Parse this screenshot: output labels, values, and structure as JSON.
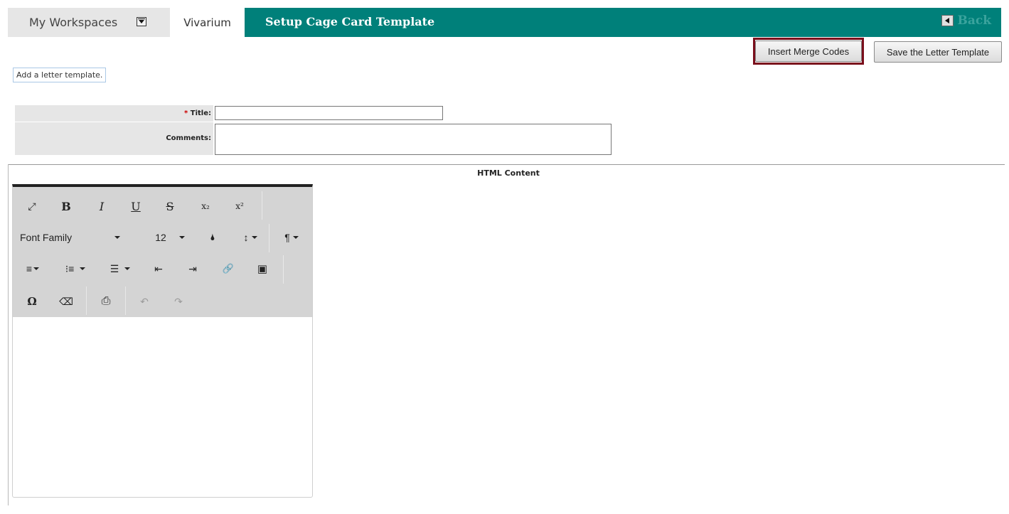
{
  "header": {
    "workspaces_label": "My Workspaces",
    "active_tab": "Vivarium",
    "page_title": "Setup Cage Card Template",
    "back_label": "Back"
  },
  "actions": {
    "insert_merge_codes": "Insert Merge Codes",
    "save_template": "Save the Letter Template"
  },
  "intro_text": "Add a letter template.",
  "form": {
    "required_mark": "*",
    "title_label": "Title:",
    "title_value": "",
    "comments_label": "Comments:",
    "comments_value": ""
  },
  "content_heading": "HTML Content",
  "editor": {
    "buttons": {
      "fullscreen": "⤢",
      "bold": "B",
      "italic": "I",
      "underline": "U",
      "strike": "S",
      "subscript": "x₂",
      "superscript": "x²",
      "font_family": "Font Family",
      "font_size": "12",
      "color": "🌢",
      "line_height": "↕",
      "paragraph": "¶",
      "align": "≡",
      "ordered_list": "⁝≡",
      "unordered_list": "☰",
      "outdent": "⇤",
      "indent": "⇥",
      "link": "🔗",
      "image": "▣",
      "special_char": "Ω",
      "clear_format": "⌫",
      "print": "⎙",
      "undo": "↶",
      "redo": "↷"
    },
    "icons": {
      "fullscreen": "expand-icon",
      "bold": "bold-icon",
      "italic": "italic-icon",
      "underline": "underline-icon",
      "strike": "strikethrough-icon",
      "subscript": "subscript-icon",
      "superscript": "superscript-icon",
      "color": "color-drop-icon",
      "line_height": "line-height-icon",
      "paragraph": "paragraph-icon",
      "align": "align-icon",
      "ordered_list": "ordered-list-icon",
      "unordered_list": "unordered-list-icon",
      "outdent": "outdent-icon",
      "indent": "indent-icon",
      "link": "link-icon",
      "image": "image-icon",
      "special_char": "omega-icon",
      "clear_format": "eraser-icon",
      "print": "print-icon",
      "undo": "undo-icon",
      "redo": "redo-icon"
    },
    "body_text": ""
  },
  "colors": {
    "header_teal": "#00807a",
    "back_text": "#3aa39d",
    "highlight_border": "#7a0f1c",
    "toolbar_bg": "#d4d4d4",
    "tab_bg": "#e6e6e6"
  }
}
